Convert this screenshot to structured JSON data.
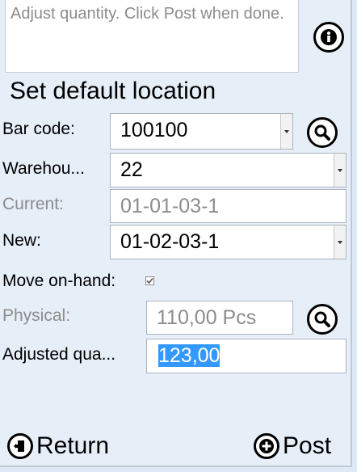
{
  "message": {
    "text": "Adjust quantity. Click Post when done."
  },
  "title": "Set default location",
  "fields": {
    "barcode": {
      "label": "Bar code:",
      "value": "100100"
    },
    "warehouse": {
      "label": "Warehou...",
      "value": "22"
    },
    "current": {
      "label": "Current:",
      "value": "01-01-03-1"
    },
    "new_location": {
      "label": "New:",
      "value": "01-02-03-1"
    },
    "move_onhand": {
      "label": "Move on-hand:",
      "checked": true
    },
    "physical": {
      "label": "Physical:",
      "value": "110,00 Pcs"
    },
    "adjusted": {
      "label": "Adjusted qua...",
      "value": "123,00"
    }
  },
  "actions": {
    "return_label": "Return",
    "post_label": "Post"
  },
  "icons": {
    "info": "info-icon",
    "search": "search-icon",
    "return": "exit-door-icon",
    "post": "plus-circle-icon"
  },
  "colors": {
    "background": "#e6eef8",
    "selection": "#3399ff",
    "dim_text": "#8c8c8c"
  }
}
